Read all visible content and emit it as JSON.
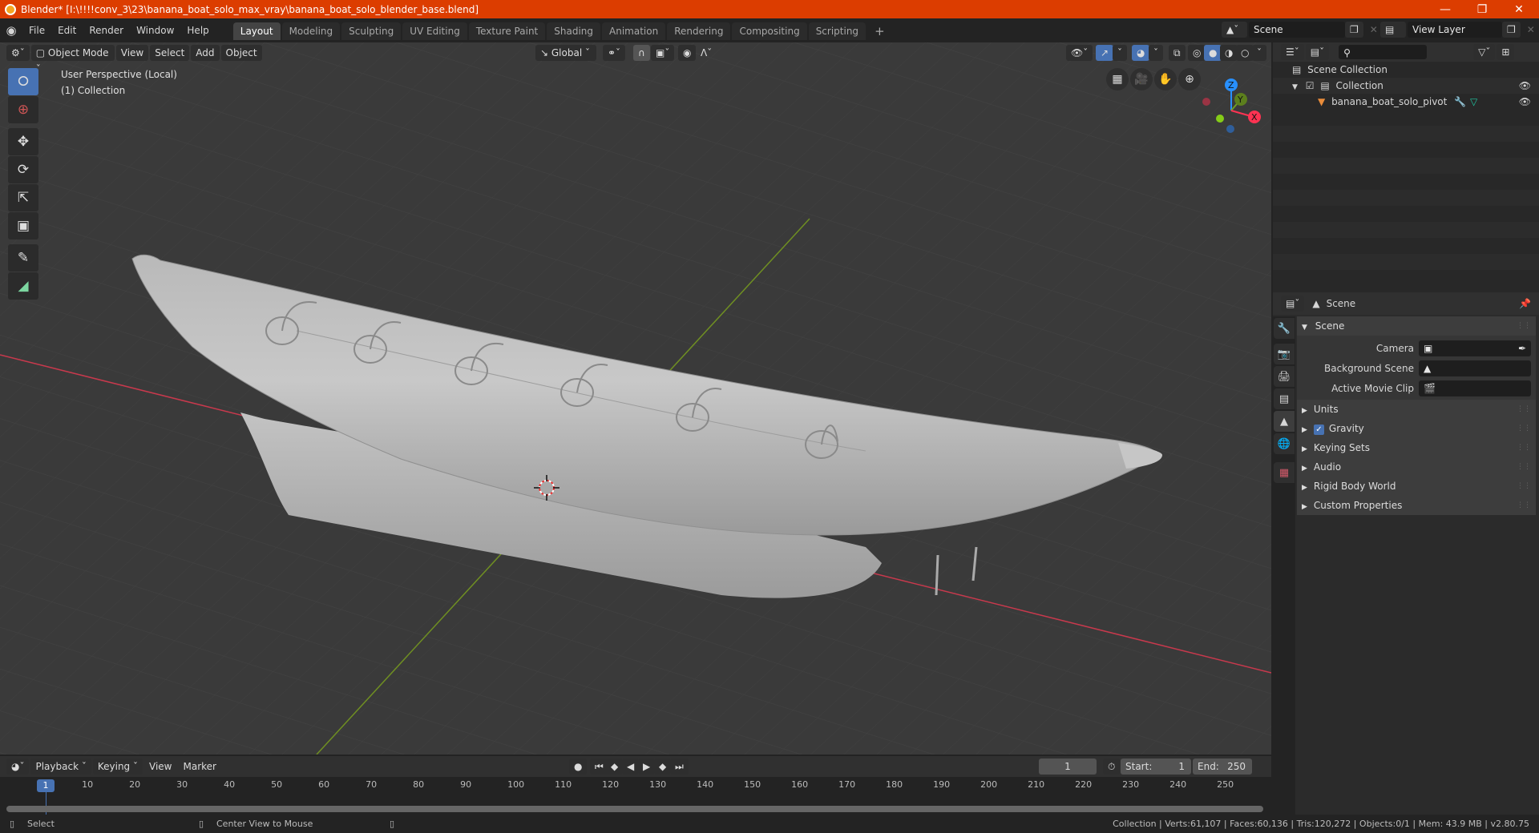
{
  "window": {
    "title": "Blender* [I:\\!!!!conv_3\\23\\banana_boat_solo_max_vray\\banana_boat_solo_blender_base.blend]",
    "controls": [
      "minimize",
      "restore",
      "close"
    ]
  },
  "menubar": {
    "menus": [
      "File",
      "Edit",
      "Render",
      "Window",
      "Help"
    ],
    "workspaces": [
      "Layout",
      "Modeling",
      "Sculpting",
      "UV Editing",
      "Texture Paint",
      "Shading",
      "Animation",
      "Rendering",
      "Compositing",
      "Scripting"
    ],
    "active_workspace": "Layout",
    "add_workspace": "+",
    "scene": "Scene",
    "view_layer": "View Layer"
  },
  "viewport": {
    "mode": "Object Mode",
    "menus": [
      "View",
      "Select",
      "Add",
      "Object"
    ],
    "orientation": "Global",
    "overlay_text": {
      "perspective": "User Perspective (Local)",
      "collection": "(1) Collection"
    },
    "tools": [
      "select-box",
      "cursor",
      "move",
      "rotate",
      "scale",
      "transform",
      "annotate",
      "measure"
    ],
    "active_tool": "select-box",
    "gizmo_axes": [
      "Z",
      "Y",
      "X"
    ],
    "axis_colors": {
      "x": "#ff3352",
      "y": "#8bdc00",
      "z": "#2890ff"
    },
    "viewport_shading": "solid"
  },
  "outliner": {
    "search_placeholder": "",
    "root": "Scene Collection",
    "collection": "Collection",
    "object": "banana_boat_solo_pivot",
    "object_icon_color": "#e98c3a"
  },
  "properties": {
    "context": "Scene",
    "panel_title": "Scene",
    "fields": [
      {
        "label": "Camera",
        "value": ""
      },
      {
        "label": "Background Scene",
        "value": ""
      },
      {
        "label": "Active Movie Clip",
        "value": ""
      }
    ],
    "sections": [
      {
        "label": "Units",
        "checkbox": false
      },
      {
        "label": "Gravity",
        "checkbox": true,
        "checked": true
      },
      {
        "label": "Keying Sets",
        "checkbox": false
      },
      {
        "label": "Audio",
        "checkbox": false
      },
      {
        "label": "Rigid Body World",
        "checkbox": false
      },
      {
        "label": "Custom Properties",
        "checkbox": false
      }
    ]
  },
  "timeline": {
    "menus": [
      "Playback",
      "Keying",
      "View",
      "Marker"
    ],
    "current_frame": "1",
    "start_label": "Start:",
    "start": "1",
    "end_label": "End:",
    "end": "250",
    "ticks": [
      "10",
      "20",
      "30",
      "40",
      "50",
      "60",
      "70",
      "80",
      "90",
      "100",
      "110",
      "120",
      "130",
      "140",
      "150",
      "160",
      "170",
      "180",
      "190",
      "200",
      "210",
      "220",
      "230",
      "240",
      "250"
    ],
    "playhead": "1"
  },
  "statusbar": {
    "left_action": "Select",
    "middle_action": "Center View to Mouse",
    "stats": "Collection | Verts:61,107 | Faces:60,136 | Tris:120,272 | Objects:0/1 | Mem: 43.9 MB | v2.80.75"
  }
}
